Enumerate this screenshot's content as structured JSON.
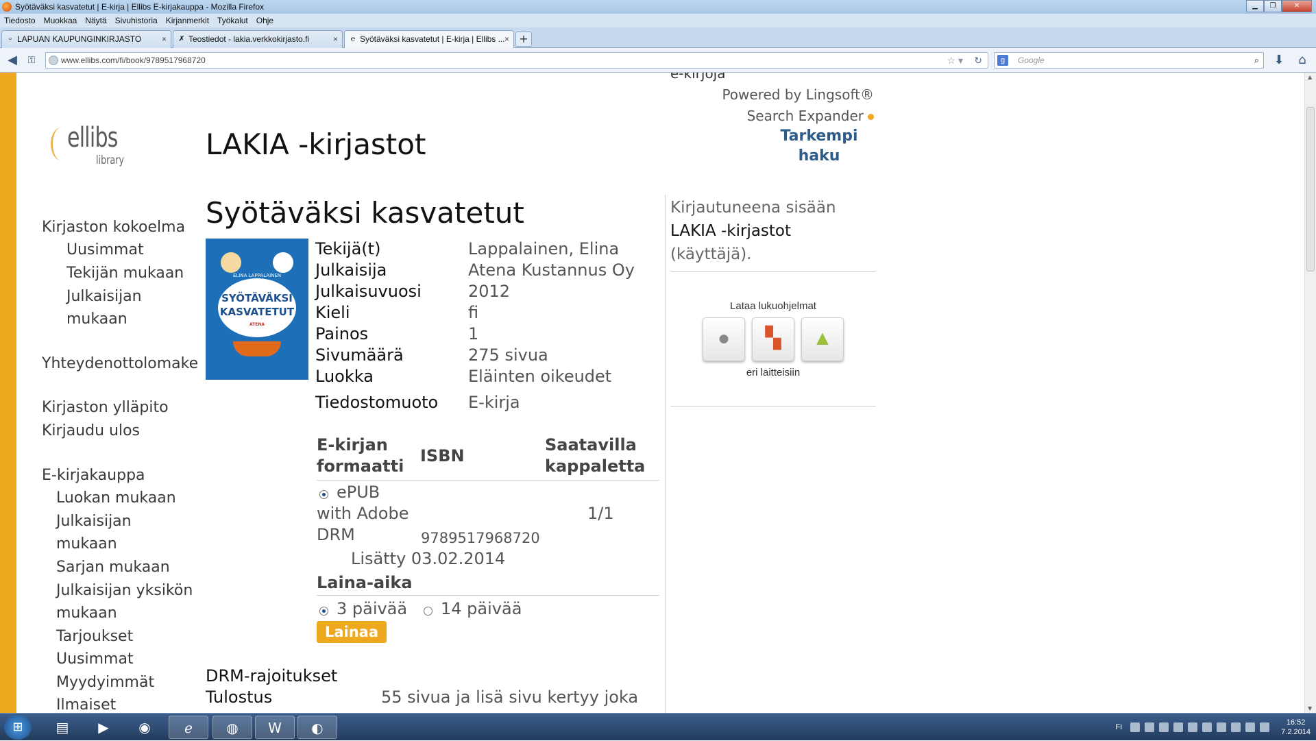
{
  "window": {
    "title": "Syötäväksi kasvatetut | E-kirja | Ellibs E-kirjakauppa - Mozilla Firefox"
  },
  "menu": [
    "Tiedosto",
    "Muokkaa",
    "Näytä",
    "Sivuhistoria",
    "Kirjanmerkit",
    "Työkalut",
    "Ohje"
  ],
  "tabs": [
    {
      "label": "LAPUAN KAUPUNGINKIRJASTO",
      "close": "×"
    },
    {
      "label": "Teostiedot - lakia.verkkokirjasto.fi",
      "close": "×"
    },
    {
      "label": "Syötäväksi kasvatetut | E-kirja | Ellibs ...",
      "close": "×"
    }
  ],
  "navbar": {
    "url": "www.ellibs.com/fi/book/9789517968720",
    "search_placeholder": "Google"
  },
  "logo": {
    "word": "ellibs",
    "sub": "library"
  },
  "site_title": "LAKIA -kirjastot",
  "top_right": {
    "cut_text": "e-kirjoja",
    "powered": "Powered by Lingsoft®",
    "expander": "Search Expander",
    "advanced": "Tarkempi haku"
  },
  "left_nav": {
    "collection": "Kirjaston kokoelma",
    "newest": "Uusimmat",
    "by_author": "Tekijän mukaan",
    "by_publisher_1": "Julkaisijan",
    "by_publisher_2": "mukaan",
    "contact": "Yhteydenottolomake",
    "admin": "Kirjaston ylläpito",
    "logout": "Kirjaudu ulos",
    "store": "E-kirjakauppa",
    "by_category": "Luokan mukaan",
    "store_by_publisher_1": "Julkaisijan",
    "store_by_publisher_2": "mukaan",
    "by_series": "Sarjan mukaan",
    "by_unit_1": "Julkaisijan yksikön",
    "by_unit_2": "mukaan",
    "offers": "Tarjoukset",
    "store_newest": "Uusimmat",
    "bestsellers": "Myydyimmät",
    "free": "Ilmaiset"
  },
  "book": {
    "title": "Syötäväksi kasvatetut",
    "cover": {
      "author": "ELINA LAPPALAINEN",
      "line1": "SYÖTÄVÄKSI",
      "line2": "KASVATETUT",
      "publisher": "ATENA"
    },
    "meta": [
      {
        "label": "Tekijä(t)",
        "value": "Lappalainen, Elina"
      },
      {
        "label": "Julkaisija",
        "value": "Atena Kustannus Oy"
      },
      {
        "label": "Julkaisuvuosi",
        "value": "2012"
      },
      {
        "label": "Kieli",
        "value": "fi"
      },
      {
        "label": "Painos",
        "value": "1"
      },
      {
        "label": "Sivumäärä",
        "value": "275 sivua"
      },
      {
        "label": "Luokka",
        "value": "Eläinten oikeudet"
      },
      {
        "label": "Tiedostomuoto",
        "value": "E-kirja"
      }
    ]
  },
  "formats": {
    "col_format_1": "E-kirjan",
    "col_format_2": "formaatti",
    "col_isbn": "ISBN",
    "col_avail_1": "Saatavilla",
    "col_avail_2": "kappaletta",
    "format_1": "ePUB",
    "format_2": "with Adobe",
    "format_3": "DRM",
    "isbn": "9789517968720",
    "available": "1/1",
    "added": "Lisätty 03.02.2014"
  },
  "loan": {
    "heading": "Laina-aika",
    "opt1": "3 päivää",
    "opt2": "14 päivää",
    "button": "Lainaa >"
  },
  "drm": {
    "heading": "DRM-rajoitukset",
    "print_label": "Tulostus",
    "print_value": "55 sivua ja lisä sivu kertyy joka"
  },
  "login": {
    "line1": "Kirjautuneena sisään",
    "library": "LAKIA -kirjastot",
    "role": "(käyttäjä)."
  },
  "readers": {
    "caption": "Lataa lukuohjelmat",
    "sub": "eri laitteisiin"
  },
  "taskbar": {
    "lang": "FI",
    "time": "16:52",
    "date": "7.2.2014"
  }
}
